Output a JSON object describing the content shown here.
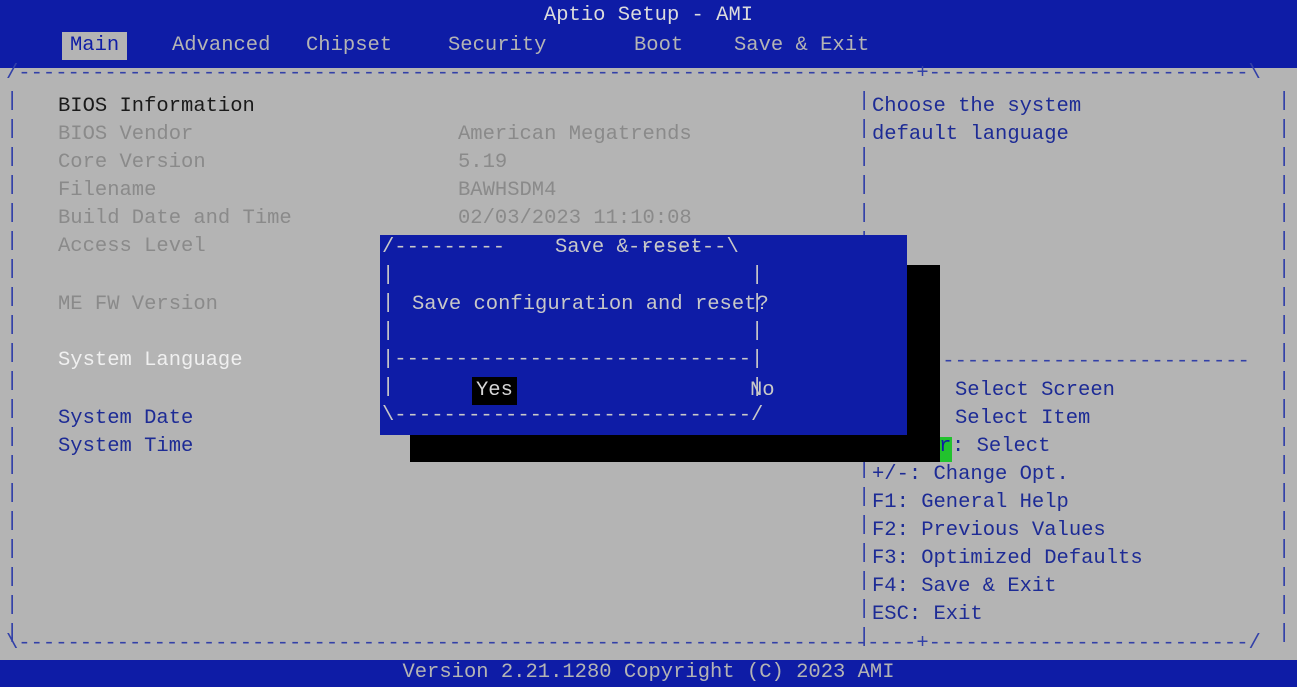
{
  "header": {
    "title": "Aptio Setup - AMI",
    "tabs": [
      "Main",
      "Advanced",
      "Chipset",
      "Security",
      "Boot",
      "Save & Exit"
    ],
    "active_tab": "Main"
  },
  "main": {
    "section_title": "BIOS Information",
    "rows": [
      {
        "label": "BIOS Vendor",
        "value": "American Megatrends"
      },
      {
        "label": "Core Version",
        "value": "5.19"
      },
      {
        "label": "Filename",
        "value": "BAWHSDM4"
      },
      {
        "label": "Build Date and Time",
        "value": "02/03/2023 11:10:08"
      },
      {
        "label": "Access Level",
        "value": ""
      },
      {
        "label": "ME FW Version",
        "value": ""
      }
    ],
    "system_language_label": "System Language",
    "system_date_label": "System Date",
    "system_time_label": "System Time"
  },
  "help": {
    "description_line1": "Choose the system",
    "description_line2": "default language",
    "keys": [
      "Select Screen",
      "Select Item",
      ": Select",
      "+/-: Change Opt.",
      "F1: General Help",
      "F2: Previous Values",
      "F3: Optimized Defaults",
      "F4: Save & Exit",
      "ESC: Exit"
    ],
    "enter_fragment": "r"
  },
  "dialog": {
    "title": "Save & reset",
    "message": "Save configuration and reset?",
    "yes_label": "Yes",
    "no_label": "No"
  },
  "footer": {
    "text": "Version 2.21.1280 Copyright (C) 2023 AMI"
  },
  "colors": {
    "bios_blue": "#0e1ca6",
    "background_gray": "#b4b4b4",
    "highlight_white": "#f0f0f0",
    "cursor_green": "#22c22e"
  }
}
